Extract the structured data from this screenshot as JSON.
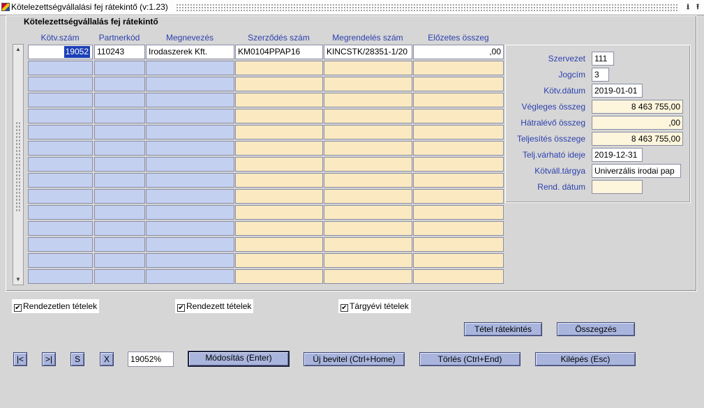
{
  "window": {
    "title": "Kötelezettségvállalási fej rátekintő (v:1.23)",
    "min_glyph": "⭳",
    "max_glyph": "⭱"
  },
  "panel": {
    "title": "Kötelezettségvállalás fej rátekintő"
  },
  "grid": {
    "columns": [
      "Kötv.szám",
      "Partnerkód",
      "Megnevezés",
      "Szerződés szám",
      "Megrendelés szám",
      "Előzetes összeg"
    ],
    "rows": [
      [
        "19052",
        "110243",
        "Irodaszerek Kft.",
        "KM0104PPAP16",
        "KINCSTK/28351-1/20",
        ",00"
      ]
    ],
    "row_count": 15
  },
  "detail": {
    "szervezet": {
      "label": "Szervezet",
      "value": "111"
    },
    "jogcim": {
      "label": "Jogcím",
      "value": "3"
    },
    "kotv_datum": {
      "label": "Kötv.dátum",
      "value": "2019-01-01"
    },
    "vegleges_osszeg": {
      "label": "Végleges összeg",
      "value": "8 463 755,00"
    },
    "hatralevo_osszeg": {
      "label": "Hátralévő összeg",
      "value": ",00"
    },
    "teljesites_osszege": {
      "label": "Teljesítés összege",
      "value": "8 463 755,00"
    },
    "telj_varhato_ideje": {
      "label": "Telj.várható ideje",
      "value": "2019-12-31"
    },
    "kotvall_targya": {
      "label": "Kötváll.tárgya",
      "value": "Univerzális irodai pap"
    },
    "rend_datum": {
      "label": "Rend. dátum",
      "value": ""
    }
  },
  "filters": {
    "rendezetlen": {
      "label": "Rendezetlen tételek",
      "checked": true
    },
    "rendezett": {
      "label": "Rendezett tételek",
      "checked": true
    },
    "targyevi": {
      "label": "Tárgyévi tételek",
      "checked": true
    }
  },
  "buttons": {
    "tetel_ratekintes": "Tétel rátekintés",
    "osszegzes": "Összegzés",
    "first": "|<",
    "last": ">|",
    "s": "S",
    "x": "X",
    "modositas": "Módosítás (Enter)",
    "uj_bevitel": "Új bevitel (Ctrl+Home)",
    "torles": "Törlés (Ctrl+End)",
    "kilepes": "Kilépés (Esc)"
  },
  "record_field": {
    "value": "19052%"
  },
  "colors": {
    "label_blue": "#2b3fae",
    "cell_blue": "#c3d0f0",
    "cell_tan": "#fbe9c2",
    "button": "#a9b5dd",
    "selection": "#1b3fb8"
  }
}
